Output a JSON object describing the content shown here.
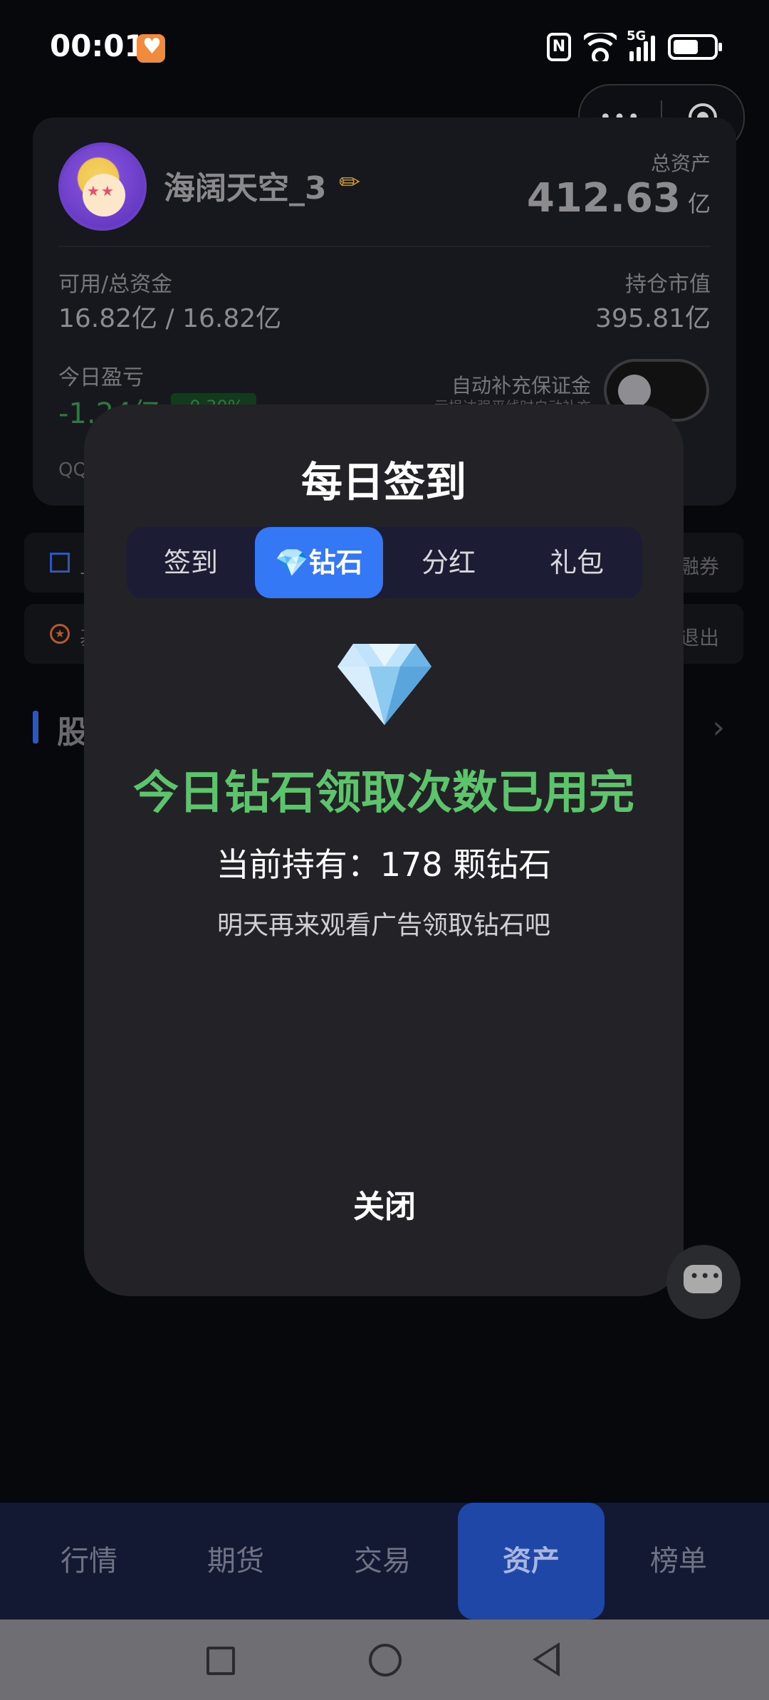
{
  "status_bar": {
    "time": "00:01",
    "network": "5G"
  },
  "capsule": {
    "more": "•••"
  },
  "account": {
    "username": "海阔天空_3",
    "total_assets_label": "总资产",
    "total_assets_value": "412.63",
    "total_assets_unit": "亿",
    "funds_label": "可用/总资金",
    "funds_value": "16.82亿 / 16.82亿",
    "position_label": "持仓市值",
    "position_value": "395.81亿",
    "pnl_label": "今日盈亏",
    "pnl_value": "-1.24亿",
    "pnl_badge": "-0.30%",
    "auto_margin_label": "自动补充保证金",
    "auto_margin_sub": "亏损达强平线时自动补充",
    "auto_margin_enabled": false,
    "qq_label": "QQ"
  },
  "background_rows": {
    "row1_left": "上",
    "row1_right": "融券",
    "row2_left": "基",
    "row2_right": "退出",
    "section_title": "股"
  },
  "modal": {
    "title": "每日签到",
    "tabs": [
      "签到",
      "💎钻石",
      "分红",
      "礼包"
    ],
    "active_tab": 1,
    "status_text": "今日钻石领取次数已用完",
    "holding_text": "当前持有：178 颗钻石",
    "hint_text": "明天再来观看广告领取钻石吧",
    "close_label": "关闭"
  },
  "bottom_nav": {
    "items": [
      "行情",
      "期货",
      "交易",
      "资产",
      "榜单"
    ],
    "active": 3
  },
  "colors": {
    "accent_blue": "#3478f6",
    "success_green": "#5cc46a",
    "modal_bg": "#232327",
    "nav_active": "#1e47a8"
  }
}
